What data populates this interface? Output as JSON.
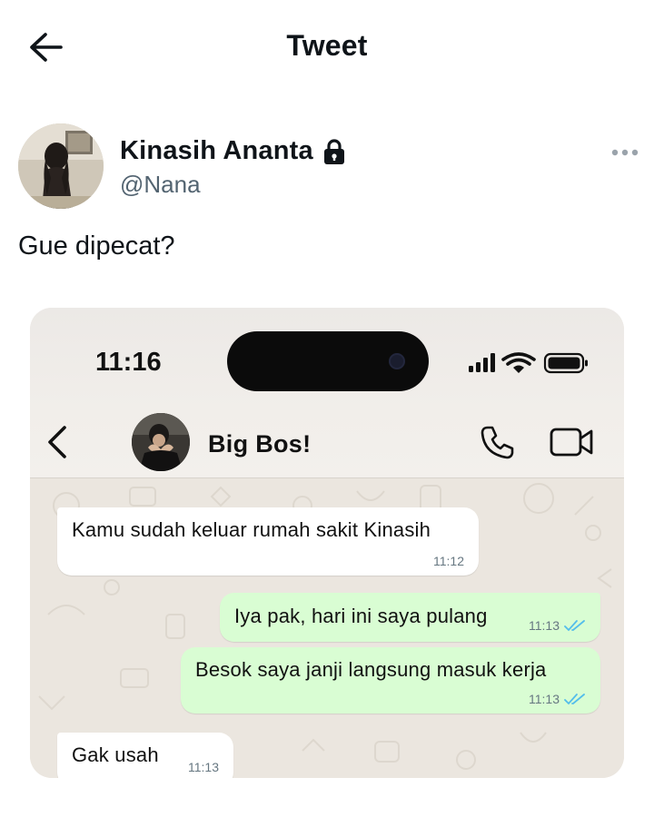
{
  "tweet_header": {
    "title": "Tweet"
  },
  "author": {
    "name": "Kinasih Ananta",
    "handle": "@Nana",
    "protected_icon": "lock-icon"
  },
  "tweet": {
    "text": "Gue dipecat?"
  },
  "media": {
    "status_bar": {
      "time": "11:16",
      "icons": [
        "cellular-signal-icon",
        "wifi-icon",
        "battery-icon"
      ]
    },
    "chat": {
      "contact_name": "Big Bos!",
      "actions": [
        "voice-call-icon",
        "video-call-icon"
      ],
      "messages": [
        {
          "direction": "incoming",
          "text": "Kamu sudah keluar rumah sakit Kinasih",
          "time": "11:12"
        },
        {
          "direction": "outgoing",
          "text": "Iya pak, hari ini saya pulang",
          "time": "11:13",
          "status": "read"
        },
        {
          "direction": "outgoing",
          "text": "Besok saya janji langsung masuk kerja",
          "time": "11:13",
          "status": "read"
        },
        {
          "direction": "incoming",
          "text": "Gak usah",
          "time": "11:13"
        }
      ]
    }
  },
  "colors": {
    "outgoing_bubble": "#d9fdd3",
    "incoming_bubble": "#ffffff",
    "read_ticks": "#53bdeb",
    "handle_gray": "#536471",
    "chat_wallpaper": "#ebe6df"
  }
}
